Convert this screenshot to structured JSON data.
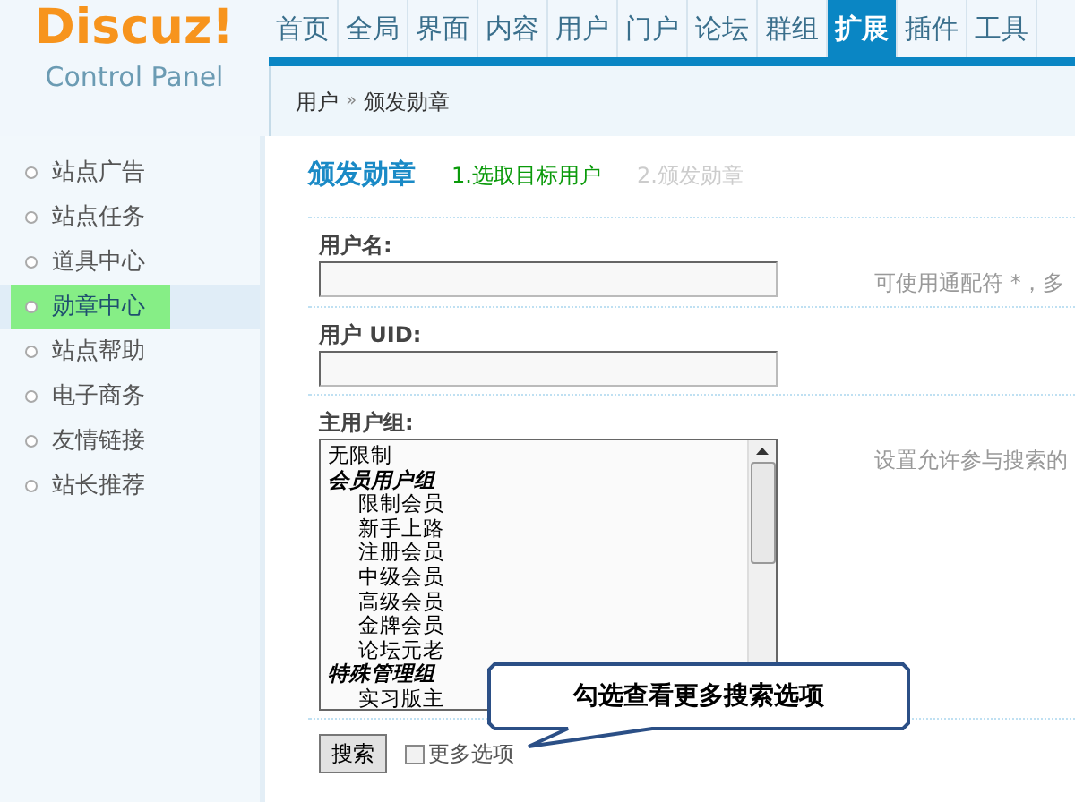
{
  "logo": {
    "title": "Discuz!",
    "subtitle": "Control Panel"
  },
  "nav": [
    {
      "label": "首页",
      "selected": false
    },
    {
      "label": "全局",
      "selected": false
    },
    {
      "label": "界面",
      "selected": false
    },
    {
      "label": "内容",
      "selected": false
    },
    {
      "label": "用户",
      "selected": false
    },
    {
      "label": "门户",
      "selected": false
    },
    {
      "label": "论坛",
      "selected": false
    },
    {
      "label": "群组",
      "selected": false
    },
    {
      "label": "扩展",
      "selected": true
    },
    {
      "label": "插件",
      "selected": false
    },
    {
      "label": "工具",
      "selected": false
    }
  ],
  "breadcrumb": [
    "用户",
    "»",
    "颁发勋章"
  ],
  "sidebar": {
    "items": [
      {
        "label": "站点广告",
        "selected": false
      },
      {
        "label": "站点任务",
        "selected": false
      },
      {
        "label": "道具中心",
        "selected": false
      },
      {
        "label": "勋章中心",
        "selected": true
      },
      {
        "label": "站点帮助",
        "selected": false
      },
      {
        "label": "电子商务",
        "selected": false
      },
      {
        "label": "友情链接",
        "selected": false
      },
      {
        "label": "站长推荐",
        "selected": false
      }
    ]
  },
  "page_title": "颁发勋章",
  "steps": [
    {
      "label": "1.选取目标用户",
      "selected": true
    },
    {
      "label": "2.颁发勋章",
      "selected": false
    }
  ],
  "form": {
    "fields": [
      {
        "kind": "text",
        "label": "用户名:",
        "hint": "可使用通配符 *，多"
      },
      {
        "kind": "text",
        "label": "用户 UID:"
      },
      {
        "kind": "list",
        "label": "主用户组:",
        "hint": "设置允许参与搜索的",
        "options": [
          {
            "kind": "option",
            "label": "无限制"
          },
          {
            "kind": "group",
            "label": "会员用户组"
          },
          {
            "kind": "option",
            "label": "限制会员"
          },
          {
            "kind": "option",
            "label": "新手上路"
          },
          {
            "kind": "option",
            "label": "注册会员"
          },
          {
            "kind": "option",
            "label": "中级会员"
          },
          {
            "kind": "option",
            "label": "高级会员"
          },
          {
            "kind": "option",
            "label": "金牌会员"
          },
          {
            "kind": "option",
            "label": "论坛元老"
          },
          {
            "kind": "group",
            "label": "特殊管理组"
          },
          {
            "kind": "option",
            "label": "实习版主"
          }
        ]
      }
    ],
    "search_button": "搜索",
    "more_options": {
      "label": "更多选项",
      "checked": false
    }
  },
  "callout": "勾选查看更多搜索选项"
}
